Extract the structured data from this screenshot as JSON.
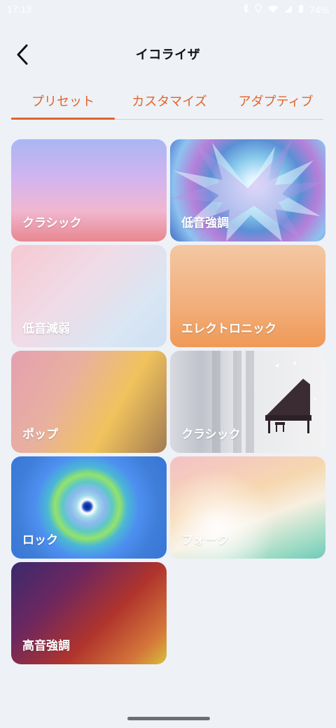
{
  "status_bar": {
    "time": "17:13",
    "battery": "74%"
  },
  "header": {
    "title": "イコライザ",
    "back_icon": "back-chevron-icon"
  },
  "tabs": [
    {
      "label": "プリセット",
      "selected": true
    },
    {
      "label": "カスタマイズ",
      "selected": false
    },
    {
      "label": "アダプティブ",
      "selected": false
    }
  ],
  "presets": [
    {
      "label": "クラシック"
    },
    {
      "label": "低音強調"
    },
    {
      "label": "低音減弱"
    },
    {
      "label": "エレクトロニック"
    },
    {
      "label": "ポップ"
    },
    {
      "label": "クラシック"
    },
    {
      "label": "ロック"
    },
    {
      "label": "フォーク"
    },
    {
      "label": "高音強調"
    }
  ],
  "colors": {
    "accent": "#e0652a",
    "background": "#eef1f6"
  }
}
